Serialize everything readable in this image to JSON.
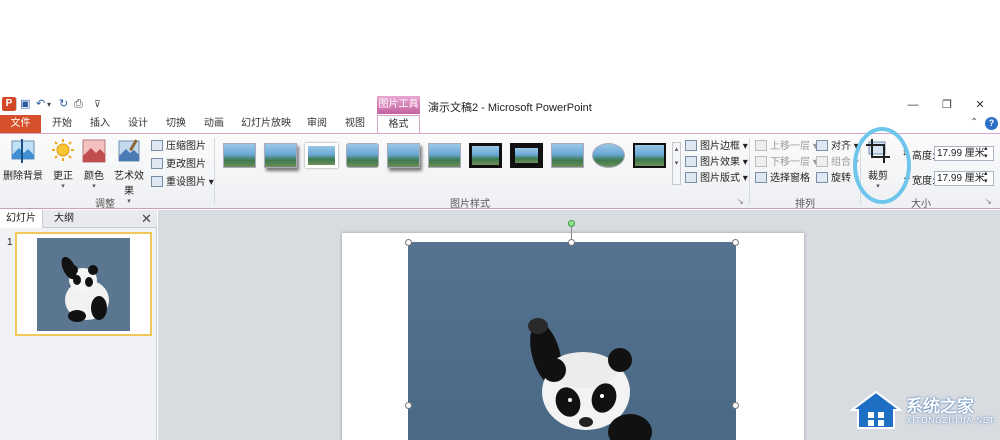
{
  "title_bar": {
    "doc_title": "演示文稿2 - Microsoft PowerPoint",
    "tools_badge": "图片工具"
  },
  "tabs": [
    {
      "label": "文件"
    },
    {
      "label": "开始"
    },
    {
      "label": "插入"
    },
    {
      "label": "设计"
    },
    {
      "label": "切换"
    },
    {
      "label": "动画"
    },
    {
      "label": "幻灯片放映"
    },
    {
      "label": "审阅"
    },
    {
      "label": "视图"
    },
    {
      "label": "格式"
    }
  ],
  "adjust": {
    "remove_bg": "删除背景",
    "correct": "更正",
    "color": "颜色",
    "art_effects": "艺术效果",
    "compress": "压缩图片",
    "change_pic": "更改图片",
    "reset_pic": "重设图片",
    "group_label": "调整"
  },
  "pic_styles": {
    "border": "图片边框",
    "effects": "图片效果",
    "layout": "图片版式",
    "group_label": "图片样式"
  },
  "arrange": {
    "bring_forward": "上移一层",
    "send_backward": "下移一层",
    "selection_pane": "选择窗格",
    "align": "对齐",
    "group": "组合",
    "rotate": "旋转",
    "group_label": "排列"
  },
  "size": {
    "crop": "裁剪",
    "height_label": "高度:",
    "height_value": "17.99 厘米",
    "width_label": "宽度:",
    "width_value": "17.99 厘米",
    "group_label": "大小"
  },
  "left_panel": {
    "tab_slides": "幻灯片",
    "tab_outline": "大纲",
    "slide_number": "1"
  },
  "watermark": {
    "text": "系统之家",
    "sub": "XITONGZHIJIA.NET"
  }
}
